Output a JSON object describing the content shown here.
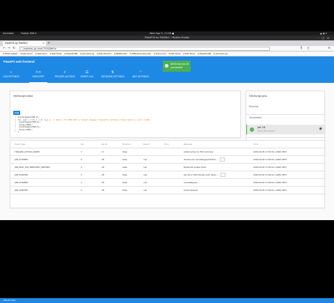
{
  "gnome": {
    "activities": "Activities",
    "app_menu": "Firefox ESR ▾",
    "clock": "Wed Sep 5, 17:06 ●",
    "tray": "▲ ◉ ▾"
  },
  "firefox": {
    "window_title": "PilesPOE by PiefiSkO - Mozilla Firefox",
    "tab_title": "PilesPOE by PiefiSkO",
    "url": "explorer-gc.local:3100/ReFlo",
    "bookmarks": [
      "Most Visited",
      "Kali Linux",
      "Kali Docs",
      "Kali Tools",
      "Exploit-DB",
      "Aircrack-ng",
      "Kali Forums",
      "NetHunter",
      "Offensive Security",
      "Kali Linux",
      "Kali Tools",
      "Kali Docs",
      "Exploit-DB",
      "Aircrack-ng"
    ],
    "new_tab": "+",
    "window_controls": [
      "–",
      "▢",
      "✕"
    ]
  },
  "app": {
    "title": "P4wnP1 web frontend",
    "tabs": [
      {
        "label": "USB SETTINGS",
        "icon": "usb-icon"
      },
      {
        "label": "HIDSCRIPT",
        "icon": "code-icon"
      },
      {
        "label": "TRIGGER ACTIONS",
        "icon": "bolt-icon"
      },
      {
        "label": "EVENT LOG",
        "icon": "log-icon"
      },
      {
        "label": "NETWORK SETTINGS",
        "icon": "network-icon"
      },
      {
        "label": "WIFI SETTINGS",
        "icon": "wifi-icon"
      }
    ],
    "toast": "HIDScript job 28 succeeded"
  },
  "editor": {
    "title": "HIDScript editor",
    "run_label": "RUN",
    "code_lines": [
      "moveStepped(500,0);",
      "for (var i = 0; i < 3; i++) {",
      "  moveStepped(500,0);",
      "  delay(1000);",
      "  moveStepped(500,0);",
      "  delay(1000);",
      "}"
    ],
    "comment": "// Note: LTP (MOD LED 1) target changes frequently multiple times before a work in DOS"
  },
  "jobs": {
    "title": "HIDScript jobs",
    "running": "Running",
    "succeeded": "Succeeded",
    "failed": "Failed",
    "job_name": "Job 28",
    "job_time": "Event 28 (started)"
  },
  "events": {
    "headers": [
      "Event Type",
      "Job",
      "Job ID",
      "Finished",
      "Result",
      "Error",
      "Message",
      "Time"
    ],
    "rows": [
      [
        "TRIGGER_ACTION_ADDED",
        "7",
        "17",
        "false",
        "",
        "",
        "Added action to HID Controller",
        "2018-09-05 17:05:56 +0000 CEST"
      ],
      [
        "JOB_STOPPED",
        "2",
        "28",
        "false",
        "null",
        "",
        "Iteration(0) moveStepped(500,0) ...",
        "2018-09-05 17:06:04 +0000 CEST"
      ],
      [
        "JOB_WAIT_LED_REPEATED_FINISHED",
        "3",
        "28",
        "false",
        "null",
        "",
        "Bluetooth enable finish",
        "2018-09-05 17:06:04 +0000 CEST"
      ],
      [
        "JOB_STARTED",
        "3",
        "28",
        "false",
        "null",
        "",
        "Job 28 on HID finished with return ...",
        "2018-09-05 17:06:04 +0000 CEST"
      ],
      [
        "JOB_STOPPED",
        "2",
        "28",
        "false",
        "null",
        "",
        "moveStepped ...",
        "2018-09-05 17:06:04 +0000 CEST"
      ],
      [
        "JOB_STARTED",
        "2",
        "28",
        "false",
        "null",
        "",
        "Script stopped",
        "2018-09-05 17:06:04 +0000 CEST"
      ]
    ]
  },
  "footer": "P4wnP1 ALOA"
}
